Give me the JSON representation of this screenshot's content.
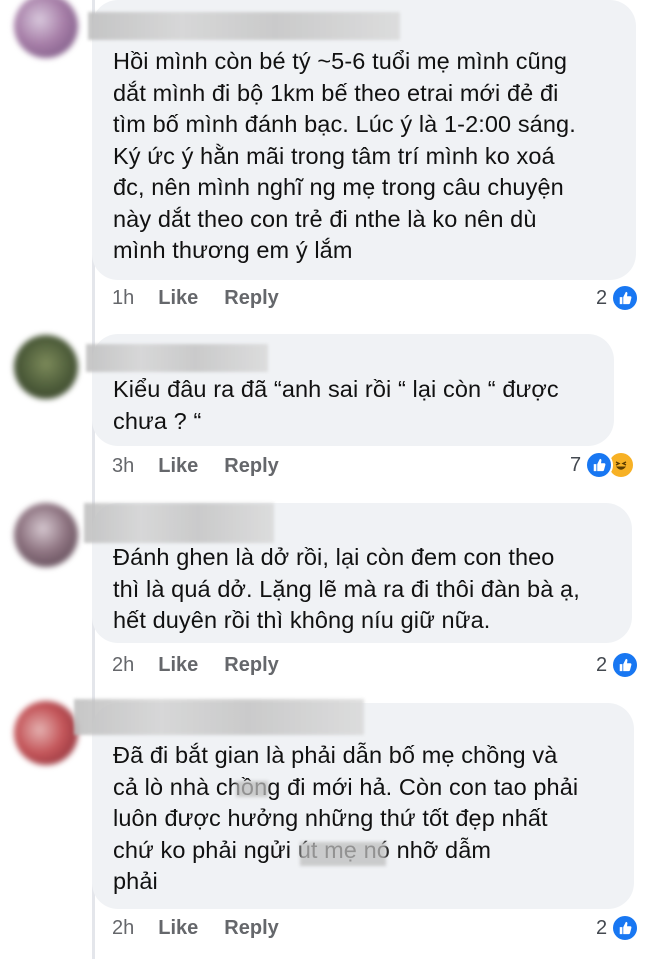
{
  "comments": [
    {
      "body": "Hồi mình còn bé tý ~5-6 tuổi mẹ mình cũng\ndắt mình đi bộ 1km bế theo etrai mới đẻ đi\ntìm bố mình đánh bạc. Lúc ý là 1-2:00 sáng.\nKý ức ý hằn mãi trong tâm trí mình ko xoá\nđc, nên mình nghĩ ng mẹ trong câu chuyện\nnày dắt theo con trẻ đi nthe là ko nên dù\nmình  thương em ý lắm",
      "time": "1h",
      "like_label": "Like",
      "reply_label": "Reply",
      "reaction_count": "2",
      "reactions": [
        "like-icon"
      ]
    },
    {
      "body": "Kiểu đâu ra đã “anh sai rồi “ lại còn “ được\nchưa ? “",
      "time": "3h",
      "like_label": "Like",
      "reply_label": "Reply",
      "reaction_count": "7",
      "reactions": [
        "like-icon",
        "haha-icon"
      ]
    },
    {
      "body": "Đánh ghen là dở rồi, lại còn đem con theo\nthì là quá dở. Lặng lẽ mà ra đi thôi đàn bà ạ,\nhết duyên rồi thì không níu giữ nữa.",
      "time": "2h",
      "like_label": "Like",
      "reply_label": "Reply",
      "reaction_count": "2",
      "reactions": [
        "like-icon"
      ]
    },
    {
      "body": "Đã đi bắt gian là phải dẫn bố mẹ chồng và\ncả lò nhà chồng đi mới hả. Còn con tao phải\nluôn được hưởng những thứ tốt đẹp nhất\nchứ ko phải ngửi       út mẹ nó nhỡ dẫm\nphải",
      "time": "2h",
      "like_label": "Like",
      "reply_label": "Reply",
      "reaction_count": "2",
      "reactions": [
        "like-icon"
      ]
    }
  ],
  "colors": {
    "bubble": "#f0f2f5",
    "meta_text": "#65676b",
    "like_blue": "#1877f2",
    "haha_yellow": "#f7b125"
  }
}
